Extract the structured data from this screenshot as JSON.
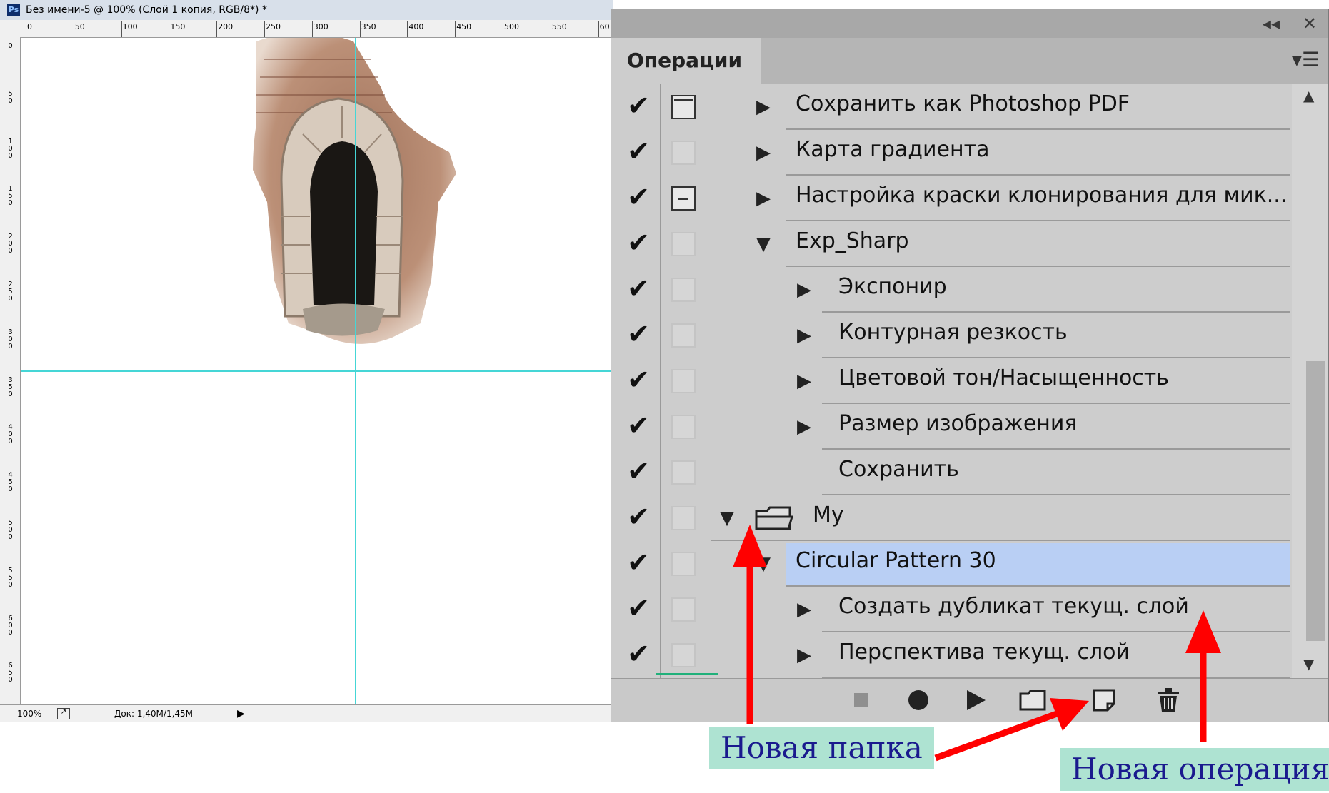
{
  "document": {
    "ps_badge": "Ps",
    "title": "Без имени-5 @ 100% (Слой 1 копия, RGB/8*) *",
    "ruler_top": [
      "0",
      "50",
      "100",
      "150",
      "200",
      "250",
      "300",
      "350",
      "400",
      "450",
      "500",
      "550",
      "60"
    ],
    "ruler_left": [
      "0",
      "50",
      "100",
      "150",
      "200",
      "250",
      "300",
      "350",
      "400",
      "450",
      "500",
      "550",
      "600",
      "650"
    ],
    "status": {
      "zoom": "100%",
      "doc": "Док: 1,40M/1,45M"
    }
  },
  "panel": {
    "tab": "Операции",
    "collapse_icon": "double-chevron-left-icon",
    "close_icon": "close-icon",
    "menu_icon": "panel-menu-icon",
    "rows": [
      {
        "label": "Сохранить как Photoshop PDF",
        "dialog": "on",
        "expanded": false,
        "indent": 1
      },
      {
        "label": "Карта градиента",
        "dialog": "off",
        "expanded": false,
        "indent": 1
      },
      {
        "label": "Настройка краски клонирования для мик...",
        "dialog": "sub",
        "expanded": false,
        "indent": 1
      },
      {
        "label": "Exp_Sharp",
        "dialog": "off",
        "expanded": true,
        "indent": 1
      },
      {
        "label": "Экспонир",
        "dialog": "off",
        "expanded": false,
        "indent": 2
      },
      {
        "label": "Контурная резкость",
        "dialog": "off",
        "expanded": false,
        "indent": 2
      },
      {
        "label": "Цветовой тон/Насыщенность",
        "dialog": "off",
        "expanded": false,
        "indent": 2
      },
      {
        "label": "Размер изображения",
        "dialog": "off",
        "expanded": false,
        "indent": 2
      },
      {
        "label": "Сохранить",
        "dialog": "off",
        "expanded": null,
        "indent": 2
      },
      {
        "label": "My",
        "dialog": "off",
        "expanded": true,
        "indent": 0,
        "folder": true
      },
      {
        "label": "Circular Pattern 30",
        "dialog": "off",
        "expanded": true,
        "indent": 1,
        "selected": true
      },
      {
        "label": "Создать дубликат текущ. слой",
        "dialog": "off",
        "expanded": false,
        "indent": 2
      },
      {
        "label": "Перспектива текущ. слой",
        "dialog": "off",
        "expanded": false,
        "indent": 2
      }
    ],
    "bottom_buttons": [
      "stop-icon",
      "record-icon",
      "play-icon",
      "new-set-folder-icon",
      "new-action-icon",
      "trash-icon"
    ]
  },
  "annotations": {
    "new_folder": "Новая папка",
    "new_action": "Новая операция"
  },
  "colors": {
    "guide": "#45d6d6",
    "selection": "#b9cff4",
    "arrow": "#ff0000",
    "callout_bg": "#aee3d2",
    "callout_text": "#1a1a8e"
  }
}
